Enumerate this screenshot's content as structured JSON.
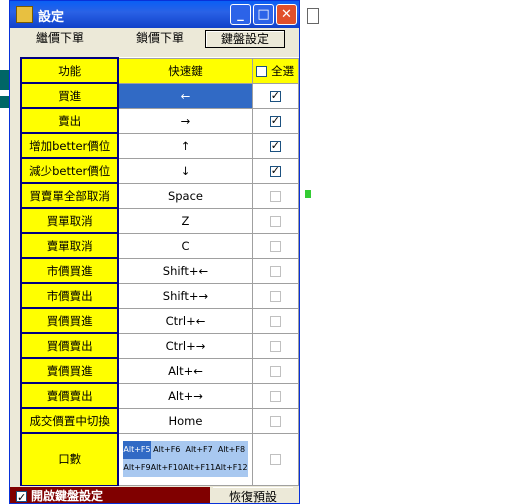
{
  "window": {
    "title": "設定"
  },
  "tabs": [
    {
      "label": "繼價下單"
    },
    {
      "label": "鎖價下單"
    },
    {
      "label": "鍵盤設定"
    }
  ],
  "table": {
    "header": {
      "function": "功能",
      "hotkey": "快速鍵",
      "select_all": "全選"
    },
    "rows": [
      {
        "function": "買進",
        "key": "←",
        "checked": true
      },
      {
        "function": "賣出",
        "key": "→",
        "checked": true
      },
      {
        "function": "增加better價位",
        "key": "↑",
        "checked": true
      },
      {
        "function": "減少better價位",
        "key": "↓",
        "checked": true
      },
      {
        "function": "買賣單全部取消",
        "key": "Space",
        "checked": false
      },
      {
        "function": "買單取消",
        "key": "Z",
        "checked": false
      },
      {
        "function": "賣單取消",
        "key": "C",
        "checked": false
      },
      {
        "function": "市價買進",
        "key": "Shift+←",
        "checked": false
      },
      {
        "function": "市價賣出",
        "key": "Shift+→",
        "checked": false
      },
      {
        "function": "買價買進",
        "key": "Ctrl+←",
        "checked": false
      },
      {
        "function": "買價賣出",
        "key": "Ctrl+→",
        "checked": false
      },
      {
        "function": "賣價買進",
        "key": "Alt+←",
        "checked": false
      },
      {
        "function": "賣價賣出",
        "key": "Alt+→",
        "checked": false
      },
      {
        "function": "成交價置中切換",
        "key": "Home",
        "checked": false
      }
    ],
    "lots": {
      "function": "口數",
      "keys": [
        "Alt+F5",
        "Alt+F6",
        "Alt+F7",
        "Alt+F8",
        "Alt+F9",
        "Alt+F10",
        "Alt+F11",
        "Alt+F12"
      ]
    }
  },
  "bottom": {
    "enable_label": "開啟鍵盤設定",
    "reset_label": "恢復預設"
  },
  "colors": {
    "function_bg": "#ffff00",
    "selected_bg": "#316ac5",
    "title_bar": "#0a5ff5",
    "bottom_bar": "#800000"
  }
}
